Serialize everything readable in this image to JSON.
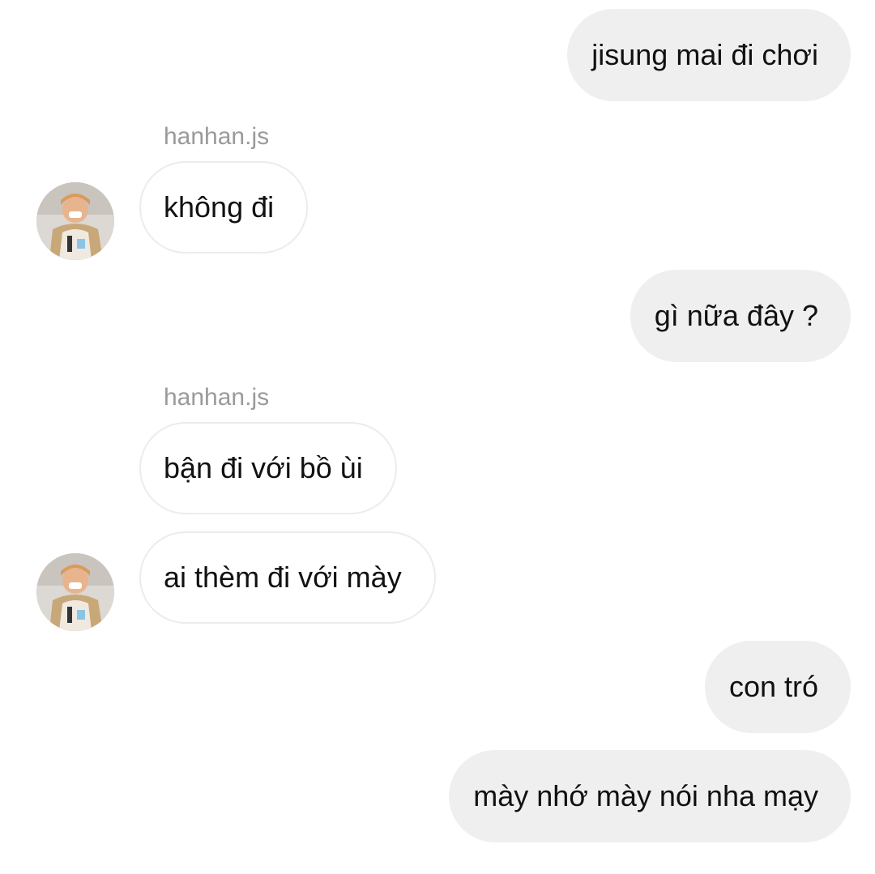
{
  "conversation": {
    "messages": [
      {
        "direction": "sent",
        "text": "jisung mai đi chơi"
      },
      {
        "direction": "received",
        "sender": "hanhan.js",
        "text": "không đi"
      },
      {
        "direction": "sent",
        "text": "gì nữa đây ?"
      },
      {
        "direction": "received",
        "sender": "hanhan.js",
        "text": "bận đi với bồ ùi"
      },
      {
        "direction": "received",
        "text": "ai thèm đi với mày"
      },
      {
        "direction": "sent",
        "text": "con tró"
      },
      {
        "direction": "sent",
        "text": "mày nhớ mày nói nha mạy"
      }
    ]
  },
  "colors": {
    "sent_bubble": "#efefef",
    "received_bubble_border": "#ececec",
    "sender_name": "#9a9a9a"
  }
}
